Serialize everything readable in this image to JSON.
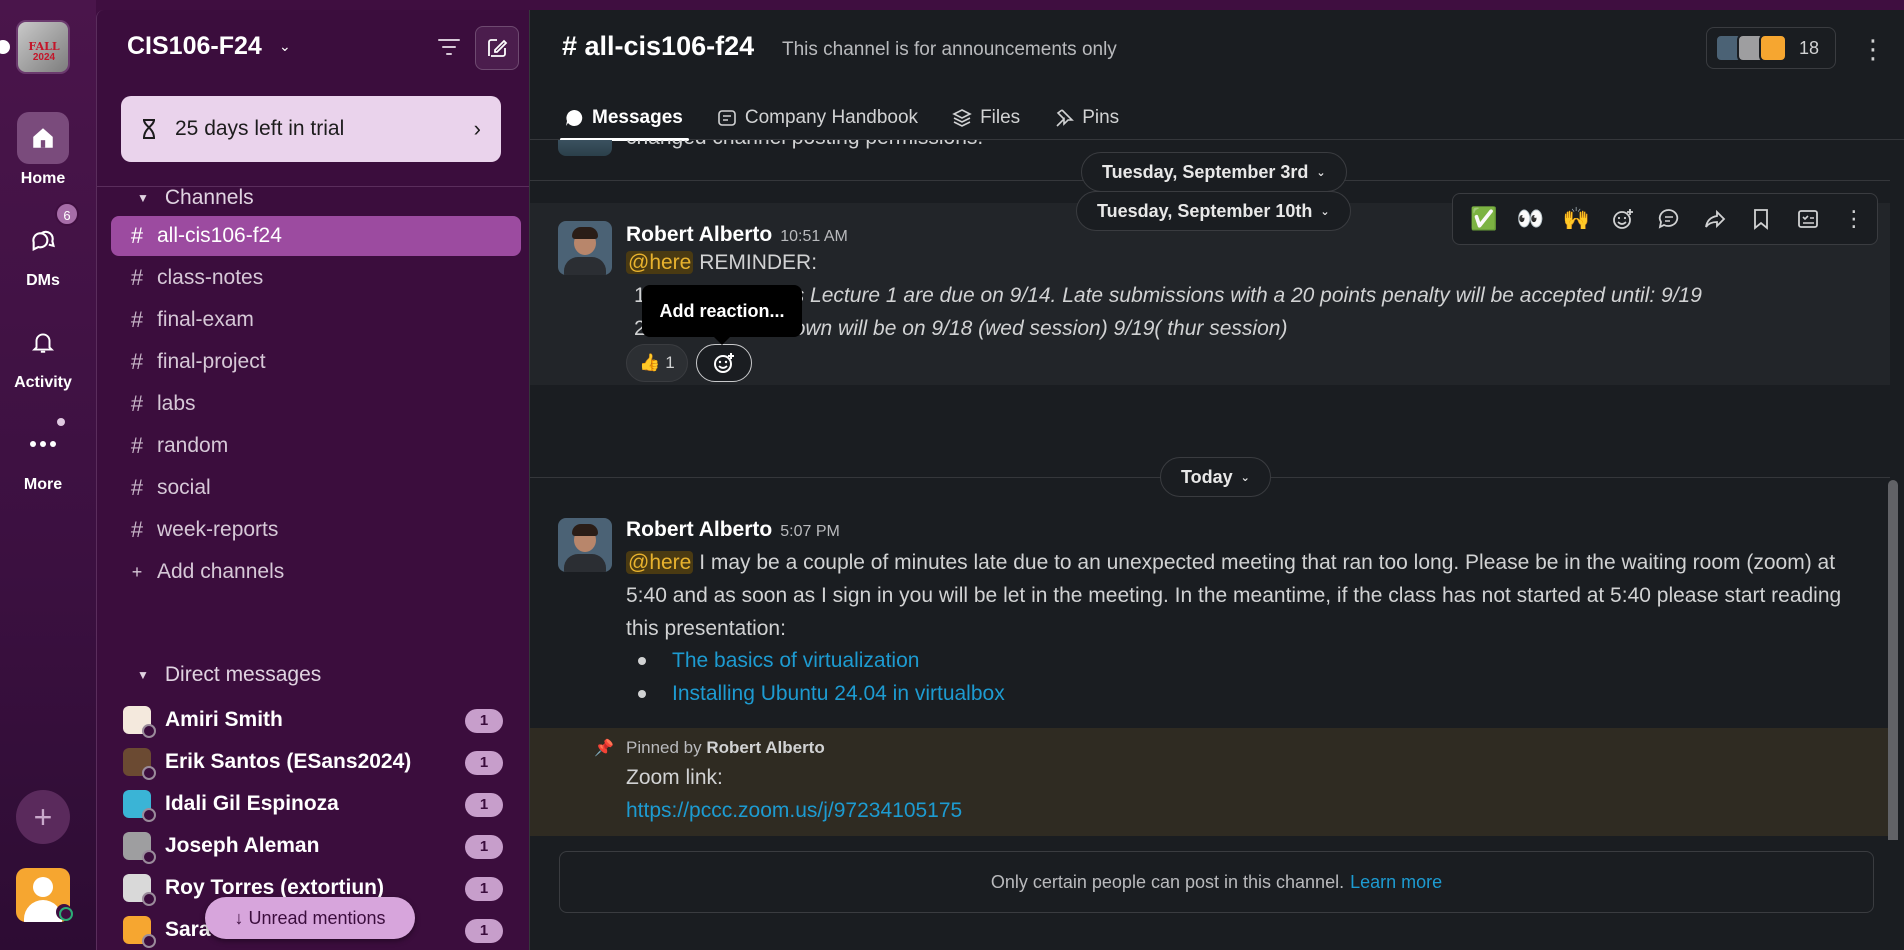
{
  "rail": {
    "workspace_logo": {
      "line1": "FALL",
      "line2": "2024"
    },
    "home_label": "Home",
    "dms_label": "DMs",
    "dms_badge": "6",
    "activity_label": "Activity",
    "more_label": "More",
    "icons": [
      "home-icon",
      "dms-icon",
      "bell-icon",
      "ellipsis-icon",
      "plus-icon"
    ]
  },
  "sidebar": {
    "workspace_name": "CIS106-F24",
    "trial_text": "25 days left in trial",
    "channels_header": "Channels",
    "channels": [
      {
        "name": "all-cis106-f24",
        "active": true
      },
      {
        "name": "class-notes"
      },
      {
        "name": "final-exam"
      },
      {
        "name": "final-project"
      },
      {
        "name": "labs"
      },
      {
        "name": "random"
      },
      {
        "name": "social"
      },
      {
        "name": "week-reports"
      }
    ],
    "add_channels": "Add channels",
    "dms_header": "Direct messages",
    "dms": [
      {
        "name": "Amiri Smith",
        "badge": "1",
        "color": "#f4e9dd"
      },
      {
        "name": "Erik Santos (ESans2024)",
        "badge": "1",
        "color": "#6b4a32"
      },
      {
        "name": "Idali Gil Espinoza",
        "badge": "1",
        "color": "#3ab4d6"
      },
      {
        "name": "Joseph Aleman",
        "badge": "1",
        "color": "#9e9ea0"
      },
      {
        "name": "Roy Torres (extortiun)",
        "badge": "1",
        "color": "#d9d9d9"
      },
      {
        "name": "Sara",
        "badge": "1",
        "color": "#f6a630"
      }
    ],
    "unread_mentions": "↓ Unread mentions"
  },
  "channel": {
    "title": "# all-cis106-f24",
    "description": "This channel is for announcements only",
    "member_count": "18",
    "tabs": [
      {
        "label": "Messages",
        "icon": "chat-bubble-icon",
        "active": true
      },
      {
        "label": "Company Handbook",
        "icon": "canvas-icon"
      },
      {
        "label": "Files",
        "icon": "layers-icon"
      },
      {
        "label": "Pins",
        "icon": "pin-icon"
      }
    ]
  },
  "messages": {
    "partial_text": "changed channel posting permissions.",
    "day1": "Tuesday, September 3rd",
    "day2": "Tuesday, September 10th",
    "msg1": {
      "author": "Robert Alberto",
      "time": "10:51 AM",
      "mention": "@here",
      "line1": "REMINDER:",
      "line2_prefix": "1",
      "line2": "s Lecture 1 are due on 9/14. Late submissions with a 20 points penalty will be accepted until: 9/19",
      "line3_prefix": "2",
      "line3": "own will be on 9/18 (wed session) 9/19( thur session)",
      "reaction_emoji": "👍",
      "reaction_count": "1",
      "tooltip": "Add reaction..."
    },
    "hover_actions": [
      "✅",
      "👀",
      "🙌",
      "add-reaction-icon",
      "reply-thread-icon",
      "forward-icon",
      "bookmark-icon",
      "reminder-icon",
      "kebab-icon"
    ],
    "day3": "Today",
    "msg2": {
      "author": "Robert Alberto",
      "time": "5:07 PM",
      "mention": "@here",
      "text": "I may be a couple of minutes late due to an unexpected meeting that ran too long. Please be in the waiting room (zoom) at 5:40 and as soon as I sign in you will be let in the meeting. In the meantime, if the class has not started at 5:40 please start reading this presentation:",
      "links": [
        "The basics of virtualization",
        "Installing Ubuntu 24.04 in virtualbox"
      ]
    },
    "pinned": {
      "label": "Pinned by",
      "by": "Robert Alberto",
      "zoom_label": "Zoom link:",
      "zoom_url": "https://pccc.zoom.us/j/97234105175"
    }
  },
  "footer": {
    "text": "Only certain people can post in this channel.",
    "link": "Learn more"
  }
}
